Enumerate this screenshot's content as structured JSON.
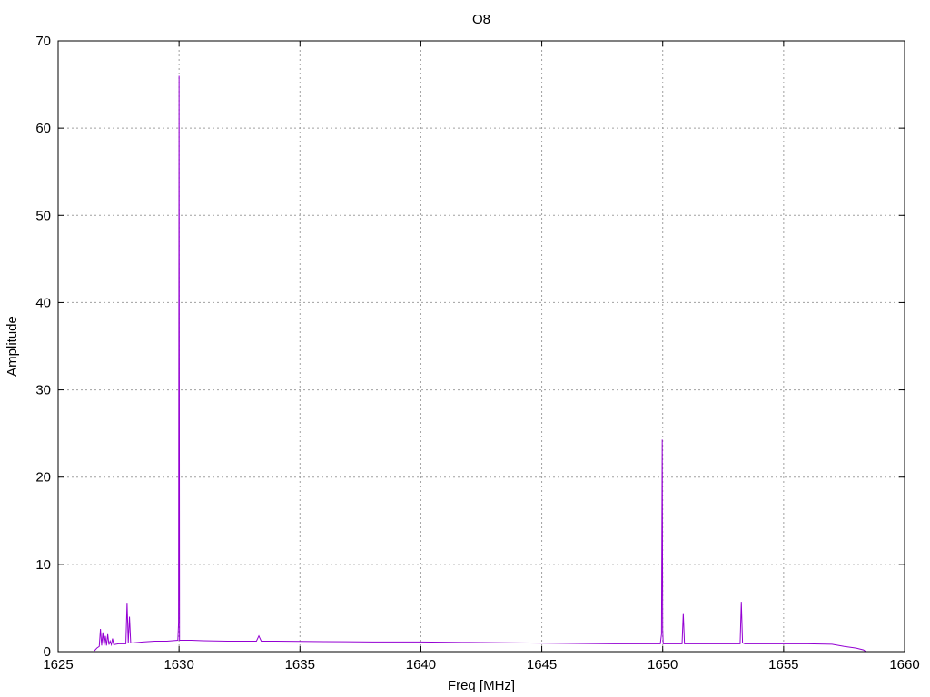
{
  "chart_data": {
    "type": "line",
    "title": "O8",
    "xlabel": "Freq [MHz]",
    "ylabel": "Amplitude",
    "xlim": [
      1625,
      1660
    ],
    "ylim": [
      0,
      70
    ],
    "xticks": [
      1625,
      1630,
      1635,
      1640,
      1645,
      1650,
      1655,
      1660
    ],
    "yticks": [
      0,
      10,
      20,
      30,
      40,
      50,
      60,
      70
    ],
    "grid": true,
    "series_color": "#9400d3",
    "series": [
      {
        "x": [
          1626.5,
          1626.6,
          1626.7,
          1626.75,
          1626.8,
          1626.85,
          1626.9,
          1626.95,
          1627.0,
          1627.05,
          1627.1,
          1627.15,
          1627.2,
          1627.25,
          1627.3,
          1627.5,
          1627.8,
          1627.85,
          1627.9,
          1627.95,
          1628.0,
          1628.05,
          1628.1,
          1628.5,
          1629.0,
          1629.5,
          1629.95,
          1629.98,
          1630.0,
          1630.02,
          1630.05,
          1630.5,
          1631.0,
          1632.0,
          1633.0,
          1633.2,
          1633.3,
          1633.4,
          1634.0,
          1636.0,
          1638.0,
          1640.0,
          1642.0,
          1644.0,
          1646.0,
          1648.0,
          1649.9,
          1649.95,
          1649.98,
          1650.0,
          1650.02,
          1650.05,
          1650.5,
          1650.8,
          1650.85,
          1650.9,
          1651.0,
          1652.0,
          1653.0,
          1653.2,
          1653.25,
          1653.3,
          1653.4,
          1654.0,
          1655.0,
          1656.0,
          1657.0,
          1657.5,
          1658.0,
          1658.3,
          1658.4
        ],
        "y": [
          0.1,
          0.4,
          0.6,
          2.6,
          0.7,
          2.2,
          0.7,
          1.8,
          0.7,
          2.0,
          0.8,
          1.2,
          0.8,
          1.5,
          0.8,
          0.9,
          0.9,
          5.6,
          1.0,
          4.0,
          1.0,
          1.0,
          1.0,
          1.1,
          1.2,
          1.2,
          1.3,
          3.3,
          66,
          1.3,
          1.3,
          1.3,
          1.25,
          1.2,
          1.2,
          1.2,
          1.8,
          1.2,
          1.2,
          1.15,
          1.1,
          1.1,
          1.05,
          1.0,
          0.95,
          0.9,
          0.9,
          2.0,
          24.3,
          2.5,
          0.9,
          0.9,
          0.9,
          0.9,
          4.4,
          0.9,
          0.9,
          0.9,
          0.9,
          0.9,
          5.7,
          1.0,
          0.9,
          0.9,
          0.9,
          0.9,
          0.85,
          0.6,
          0.4,
          0.2,
          0.0
        ]
      }
    ]
  }
}
